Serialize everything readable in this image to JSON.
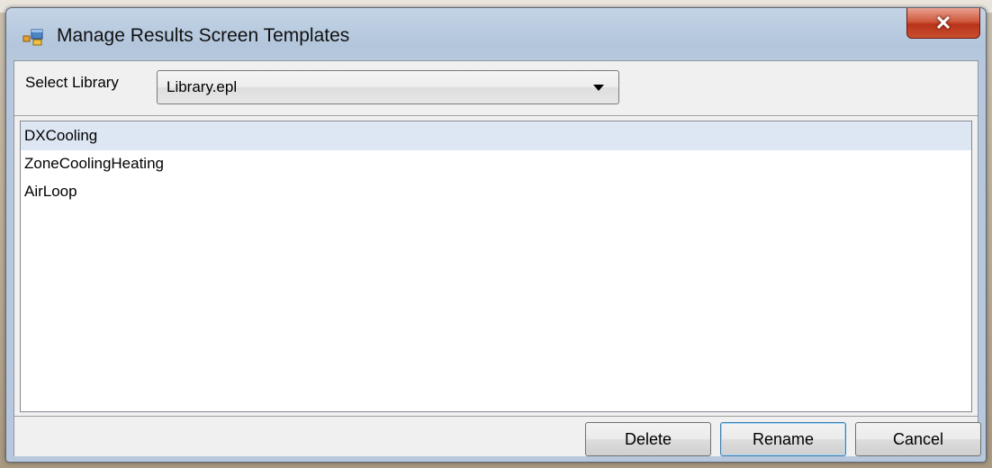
{
  "window": {
    "title": "Manage Results Screen Templates",
    "close_label": "✕"
  },
  "library": {
    "label": "Select Library",
    "selected": "Library.epl"
  },
  "templates": [
    {
      "name": "DXCooling",
      "selected": true
    },
    {
      "name": "ZoneCoolingHeating",
      "selected": false
    },
    {
      "name": "AirLoop",
      "selected": false
    }
  ],
  "buttons": {
    "delete": "Delete",
    "rename": "Rename",
    "cancel": "Cancel"
  },
  "colors": {
    "selection": "#dde6f3",
    "titlebar": "#b3c6dc",
    "close_button": "#c8502f"
  }
}
